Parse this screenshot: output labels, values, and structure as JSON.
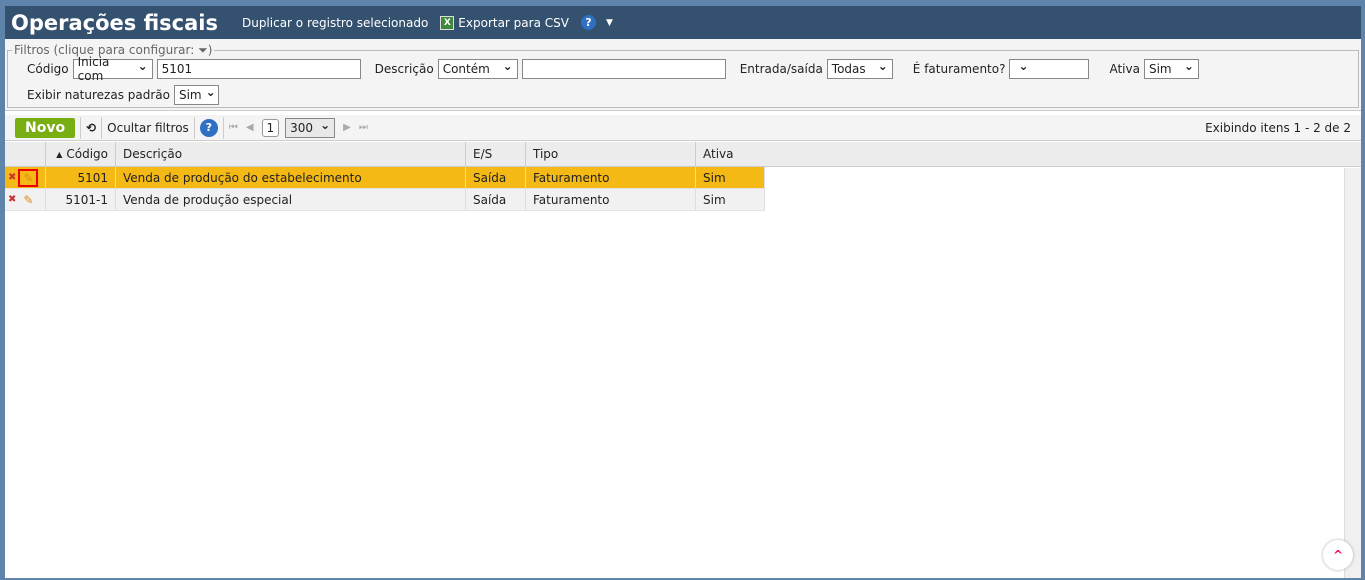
{
  "header": {
    "title": "Operações fiscais",
    "duplicate": "Duplicar o registro selecionado",
    "export": "Exportar para CSV",
    "help": "?",
    "menu": "▼"
  },
  "filters": {
    "legend": "Filtros (clique para configurar:",
    "legend_end": ")",
    "codigo_label": "Código",
    "codigo_op": "Inicia com",
    "codigo_value": "5101",
    "descricao_label": "Descrição",
    "descricao_op": "Contém",
    "descricao_value": "",
    "es_label": "Entrada/saída",
    "es_value": "Todas",
    "fat_label": "É faturamento?",
    "fat_value": "",
    "ativa_label": "Ativa",
    "ativa_value": "Sim",
    "padrao_label": "Exibir naturezas padrão",
    "padrao_value": "Sim"
  },
  "toolbar": {
    "new": "Novo",
    "hide_filters": "Ocultar filtros",
    "page": "1",
    "page_size": "300",
    "status": "Exibindo itens 1 - 2 de 2"
  },
  "grid": {
    "columns": [
      "Código",
      "Descrição",
      "E/S",
      "Tipo",
      "Ativa"
    ],
    "rows": [
      [
        "5101",
        "Venda de produção do estabelecimento",
        "Saída",
        "Faturamento",
        "Sim"
      ],
      [
        "5101-1",
        "Venda de produção especial",
        "Saída",
        "Faturamento",
        "Sim"
      ]
    ]
  }
}
